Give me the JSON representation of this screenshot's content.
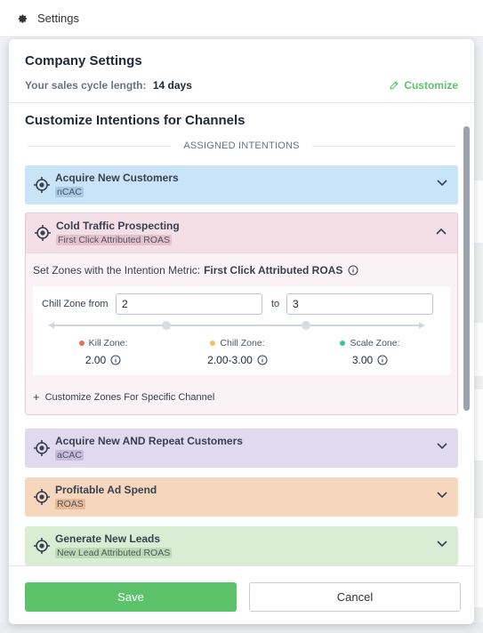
{
  "topbar": {
    "title": "Settings"
  },
  "company": {
    "heading": "Company Settings",
    "cycle_label": "Your sales cycle length:",
    "cycle_value": "14 days",
    "customize_label": "Customize"
  },
  "intentions": {
    "heading": "Customize Intentions for Channels",
    "assigned_label": "ASSIGNED INTENTIONS",
    "cards": [
      {
        "title": "Acquire New Customers",
        "tag": "nCAC",
        "color": "#c9e3f7",
        "expanded": false
      },
      {
        "title": "Cold Traffic Prospecting",
        "tag": "First Click Attributed ROAS",
        "color": "#f3dfe5",
        "expanded": true
      },
      {
        "title": "Acquire New AND Repeat Customers",
        "tag": "aCAC",
        "color": "#e1d9ee",
        "expanded": false
      },
      {
        "title": "Profitable Ad Spend",
        "tag": "ROAS",
        "color": "#f7d6be",
        "expanded": false
      },
      {
        "title": "Generate New Leads",
        "tag": "New Lead Attributed ROAS",
        "color": "#d9ecd4",
        "expanded": false
      }
    ],
    "expanded": {
      "metric_prefix": "Set Zones with the Intention Metric:",
      "metric_name": "First Click Attributed ROAS",
      "chill_from_label": "Chill Zone from",
      "chill_from_value": "2",
      "to_label": "to",
      "chill_to_value": "3",
      "zones": [
        {
          "name": "Kill Zone:",
          "value": "2.00",
          "color": "#ef6b57"
        },
        {
          "name": "Chill Zone:",
          "value": "2.00-3.00",
          "color": "#f3c064"
        },
        {
          "name": "Scale Zone:",
          "value": "3.00",
          "color": "#36c59c"
        }
      ],
      "customize_specific": "Customize Zones For Specific Channel"
    }
  },
  "footer": {
    "save_label": "Save",
    "cancel_label": "Cancel"
  },
  "colors": {
    "accent": "#5cc26a"
  }
}
